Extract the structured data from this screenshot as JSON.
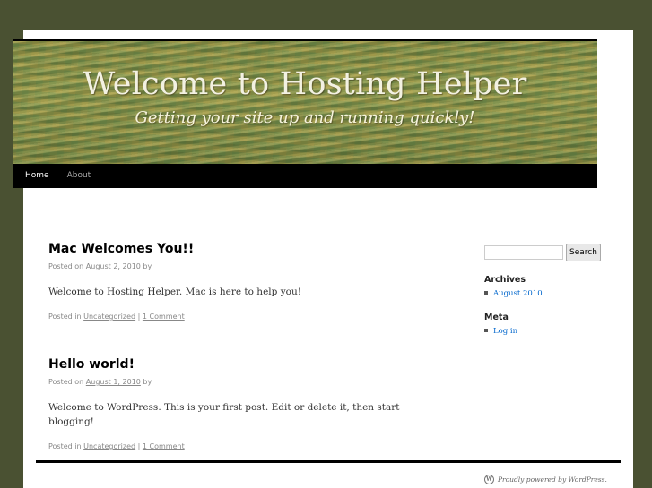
{
  "header": {
    "title": "Welcome to Hosting Helper",
    "tagline": "Getting your site up and running quickly!"
  },
  "nav": {
    "items": [
      {
        "label": "Home"
      },
      {
        "label": "About"
      }
    ]
  },
  "posts": [
    {
      "title": "Mac Welcomes You!!",
      "posted_on": "Posted on",
      "date": "August 2, 2010",
      "by": "by",
      "body": "Welcome to Hosting Helper. Mac is here to help you!",
      "posted_in": "Posted in",
      "category": "Uncategorized",
      "separator": "|",
      "comments": "1 Comment"
    },
    {
      "title": "Hello world!",
      "posted_on": "Posted on",
      "date": "August 1, 2010",
      "by": "by",
      "body": "Welcome to WordPress. This is your first post. Edit or delete it, then start blogging!",
      "posted_in": "Posted in",
      "category": "Uncategorized",
      "separator": "|",
      "comments": "1 Comment"
    }
  ],
  "sidebar": {
    "search_button": "Search",
    "search_value": "",
    "archives_title": "Archives",
    "archives": [
      "August 2010"
    ],
    "meta_title": "Meta",
    "meta": [
      "Log in"
    ]
  },
  "footer": {
    "credit": "Proudly powered by WordPress."
  },
  "colors": {
    "background": "#4a5132",
    "link": "#0066cc",
    "nav_bg": "#000000"
  }
}
